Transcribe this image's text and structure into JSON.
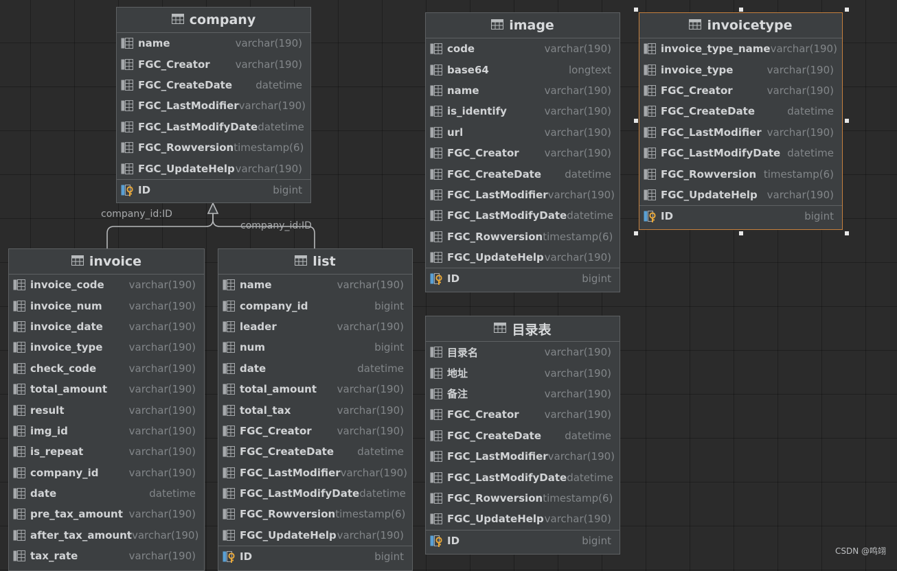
{
  "tables": {
    "company": {
      "title": "company",
      "columns": [
        {
          "name": "name",
          "type": "varchar(190)"
        },
        {
          "name": "FGC_Creator",
          "type": "varchar(190)"
        },
        {
          "name": "FGC_CreateDate",
          "type": "datetime"
        },
        {
          "name": "FGC_LastModifier",
          "type": "varchar(190)"
        },
        {
          "name": "FGC_LastModifyDate",
          "type": "datetime"
        },
        {
          "name": "FGC_Rowversion",
          "type": "timestamp(6)"
        },
        {
          "name": "FGC_UpdateHelp",
          "type": "varchar(190)"
        }
      ],
      "pk": {
        "name": "ID",
        "type": "bigint"
      }
    },
    "image": {
      "title": "image",
      "columns": [
        {
          "name": "code",
          "type": "varchar(190)"
        },
        {
          "name": "base64",
          "type": "longtext"
        },
        {
          "name": "name",
          "type": "varchar(190)"
        },
        {
          "name": "is_identify",
          "type": "varchar(190)"
        },
        {
          "name": "url",
          "type": "varchar(190)"
        },
        {
          "name": "FGC_Creator",
          "type": "varchar(190)"
        },
        {
          "name": "FGC_CreateDate",
          "type": "datetime"
        },
        {
          "name": "FGC_LastModifier",
          "type": "varchar(190)"
        },
        {
          "name": "FGC_LastModifyDate",
          "type": "datetime"
        },
        {
          "name": "FGC_Rowversion",
          "type": "timestamp(6)"
        },
        {
          "name": "FGC_UpdateHelp",
          "type": "varchar(190)"
        }
      ],
      "pk": {
        "name": "ID",
        "type": "bigint"
      }
    },
    "invoicetype": {
      "title": "invoicetype",
      "columns": [
        {
          "name": "invoice_type_name",
          "type": "varchar(190)"
        },
        {
          "name": "invoice_type",
          "type": "varchar(190)"
        },
        {
          "name": "FGC_Creator",
          "type": "varchar(190)"
        },
        {
          "name": "FGC_CreateDate",
          "type": "datetime"
        },
        {
          "name": "FGC_LastModifier",
          "type": "varchar(190)"
        },
        {
          "name": "FGC_LastModifyDate",
          "type": "datetime"
        },
        {
          "name": "FGC_Rowversion",
          "type": "timestamp(6)"
        },
        {
          "name": "FGC_UpdateHelp",
          "type": "varchar(190)"
        }
      ],
      "pk": {
        "name": "ID",
        "type": "bigint"
      }
    },
    "invoice": {
      "title": "invoice",
      "columns": [
        {
          "name": "invoice_code",
          "type": "varchar(190)"
        },
        {
          "name": "invoice_num",
          "type": "varchar(190)"
        },
        {
          "name": "invoice_date",
          "type": "varchar(190)"
        },
        {
          "name": "invoice_type",
          "type": "varchar(190)"
        },
        {
          "name": "check_code",
          "type": "varchar(190)"
        },
        {
          "name": "total_amount",
          "type": "varchar(190)"
        },
        {
          "name": "result",
          "type": "varchar(190)"
        },
        {
          "name": "img_id",
          "type": "varchar(190)"
        },
        {
          "name": "is_repeat",
          "type": "varchar(190)"
        },
        {
          "name": "company_id",
          "type": "varchar(190)"
        },
        {
          "name": "date",
          "type": "datetime"
        },
        {
          "name": "pre_tax_amount",
          "type": "varchar(190)"
        },
        {
          "name": "after_tax_amount",
          "type": "varchar(190)"
        },
        {
          "name": "tax_rate",
          "type": "varchar(190)"
        }
      ]
    },
    "list": {
      "title": "list",
      "columns": [
        {
          "name": "name",
          "type": "varchar(190)"
        },
        {
          "name": "company_id",
          "type": "bigint"
        },
        {
          "name": "leader",
          "type": "varchar(190)"
        },
        {
          "name": "num",
          "type": "bigint"
        },
        {
          "name": "date",
          "type": "datetime"
        },
        {
          "name": "total_amount",
          "type": "varchar(190)"
        },
        {
          "name": "total_tax",
          "type": "varchar(190)"
        },
        {
          "name": "FGC_Creator",
          "type": "varchar(190)"
        },
        {
          "name": "FGC_CreateDate",
          "type": "datetime"
        },
        {
          "name": "FGC_LastModifier",
          "type": "varchar(190)"
        },
        {
          "name": "FGC_LastModifyDate",
          "type": "datetime"
        },
        {
          "name": "FGC_Rowversion",
          "type": "timestamp(6)"
        },
        {
          "name": "FGC_UpdateHelp",
          "type": "varchar(190)"
        }
      ],
      "pk": {
        "name": "ID",
        "type": "bigint"
      }
    },
    "catalog": {
      "title": "目录表",
      "columns": [
        {
          "name": "目录名",
          "type": "varchar(190)"
        },
        {
          "name": "地址",
          "type": "varchar(190)"
        },
        {
          "name": "备注",
          "type": "varchar(190)"
        },
        {
          "name": "FGC_Creator",
          "type": "varchar(190)"
        },
        {
          "name": "FGC_CreateDate",
          "type": "datetime"
        },
        {
          "name": "FGC_LastModifier",
          "type": "varchar(190)"
        },
        {
          "name": "FGC_LastModifyDate",
          "type": "datetime"
        },
        {
          "name": "FGC_Rowversion",
          "type": "timestamp(6)"
        },
        {
          "name": "FGC_UpdateHelp",
          "type": "varchar(190)"
        }
      ],
      "pk": {
        "name": "ID",
        "type": "bigint"
      }
    }
  },
  "relations": [
    {
      "from": "invoice",
      "to": "company",
      "label": "company_id:ID"
    },
    {
      "from": "list",
      "to": "company",
      "label": "company_id:ID"
    }
  ],
  "watermark": "CSDN @鸣翊",
  "colors": {
    "selection_border": "#c7803d",
    "key_icon": "#e8a83a",
    "column_icon": "#a6a9ac"
  },
  "icons": {
    "table": "table-icon",
    "column": "column-icon",
    "primary_key": "primary-key-icon"
  }
}
